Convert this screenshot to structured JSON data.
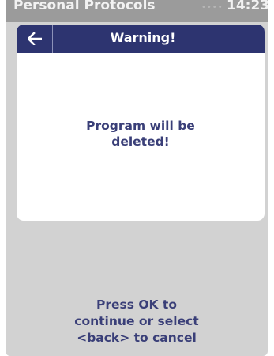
{
  "status_bar": {
    "title": "Personal Protocols",
    "signal": "••••",
    "time": "14:23"
  },
  "dialog": {
    "back_icon": "arrow-left-icon",
    "title": "Warning!",
    "message": "Program will be deleted!"
  },
  "footer": {
    "instruction": "Press OK to continue or select <back> to cancel"
  },
  "colors": {
    "header": "#2d3470",
    "text": "#3a3f78",
    "background": "#d2d2d2",
    "status_bar": "#9b9b9b"
  }
}
